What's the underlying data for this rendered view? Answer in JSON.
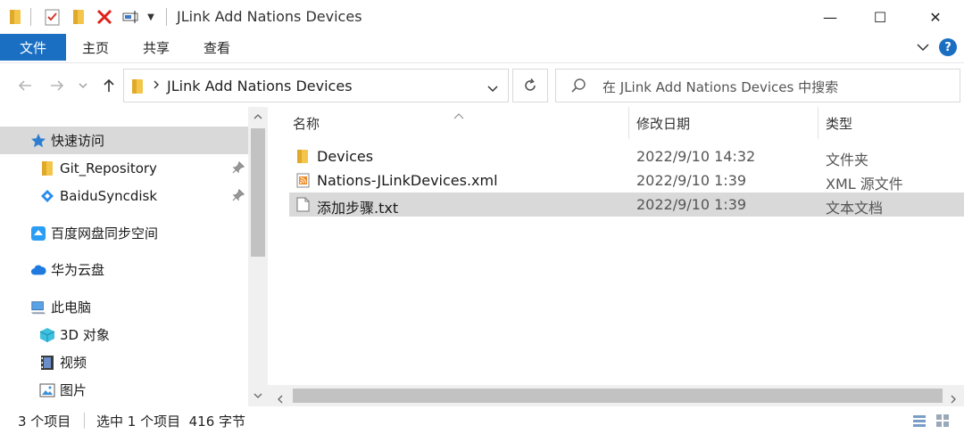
{
  "window": {
    "title": "JLink Add Nations Devices",
    "minimize_glyph": "—",
    "maximize_glyph": "☐",
    "close_glyph": "✕"
  },
  "ribbon": {
    "file_tab": "文件",
    "tabs": [
      "主页",
      "共享",
      "查看"
    ],
    "help_glyph": "?"
  },
  "address": {
    "path": "JLink Add Nations Devices",
    "search_placeholder": "在 JLink Add Nations Devices 中搜索"
  },
  "nav_pane": {
    "items": [
      {
        "label": "快速访问",
        "icon": "star-icon",
        "selected": true
      },
      {
        "label": "Git_Repository",
        "icon": "folder-icon",
        "pinned": true
      },
      {
        "label": "BaiduSyncdisk",
        "icon": "baidu-sync-icon",
        "pinned": true
      },
      {
        "label": "百度网盘同步空间",
        "icon": "baidu-netdisk-icon"
      },
      {
        "label": "华为云盘",
        "icon": "cloud-icon"
      },
      {
        "label": "此电脑",
        "icon": "computer-icon"
      },
      {
        "label": "3D 对象",
        "icon": "cube-icon"
      },
      {
        "label": "视频",
        "icon": "film-icon"
      },
      {
        "label": "图片",
        "icon": "image-icon"
      }
    ]
  },
  "file_list": {
    "columns": [
      "名称",
      "修改日期",
      "类型"
    ],
    "rows": [
      {
        "name": "Devices",
        "date": "2022/9/10 14:32",
        "type": "文件夹",
        "icon": "folder-icon",
        "selected": false
      },
      {
        "name": "Nations-JLinkDevices.xml",
        "date": "2022/9/10 1:39",
        "type": "XML 源文件",
        "icon": "xml-file-icon",
        "selected": false
      },
      {
        "name": "添加步骤.txt",
        "date": "2022/9/10 1:39",
        "type": "文本文档",
        "icon": "text-file-icon",
        "selected": true
      }
    ]
  },
  "status_bar": {
    "item_count": "3 个项目",
    "selection": "选中 1 个项目  416 字节"
  },
  "colors": {
    "accent": "#1a6fc2",
    "selection": "#d9d9d9",
    "folder": "#f3c64b"
  }
}
